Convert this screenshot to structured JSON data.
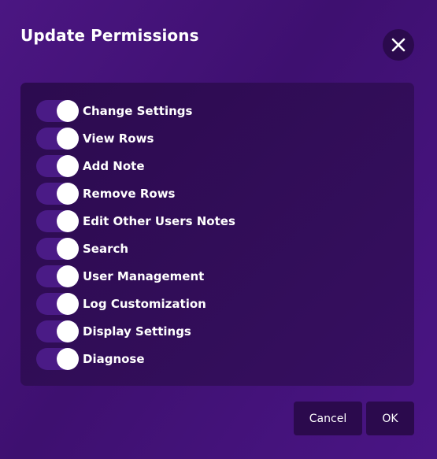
{
  "dialog": {
    "title": "Update Permissions",
    "close_icon": "close-icon",
    "permissions": [
      {
        "label": "Change Settings",
        "enabled": true
      },
      {
        "label": "View Rows",
        "enabled": true
      },
      {
        "label": "Add Note",
        "enabled": true
      },
      {
        "label": "Remove Rows",
        "enabled": true
      },
      {
        "label": "Edit Other Users Notes",
        "enabled": true
      },
      {
        "label": "Search",
        "enabled": true
      },
      {
        "label": "User Management",
        "enabled": true
      },
      {
        "label": "Log Customization",
        "enabled": true
      },
      {
        "label": "Display Settings",
        "enabled": true
      },
      {
        "label": "Diagnose",
        "enabled": true
      }
    ],
    "buttons": {
      "cancel": "Cancel",
      "ok": "OK"
    }
  },
  "colors": {
    "background": "#43127a",
    "panel": "#300d57",
    "button": "#2b0a4d",
    "toggle_track": "#4a1b86",
    "toggle_knob": "#ffffff",
    "text": "#ffffff"
  }
}
